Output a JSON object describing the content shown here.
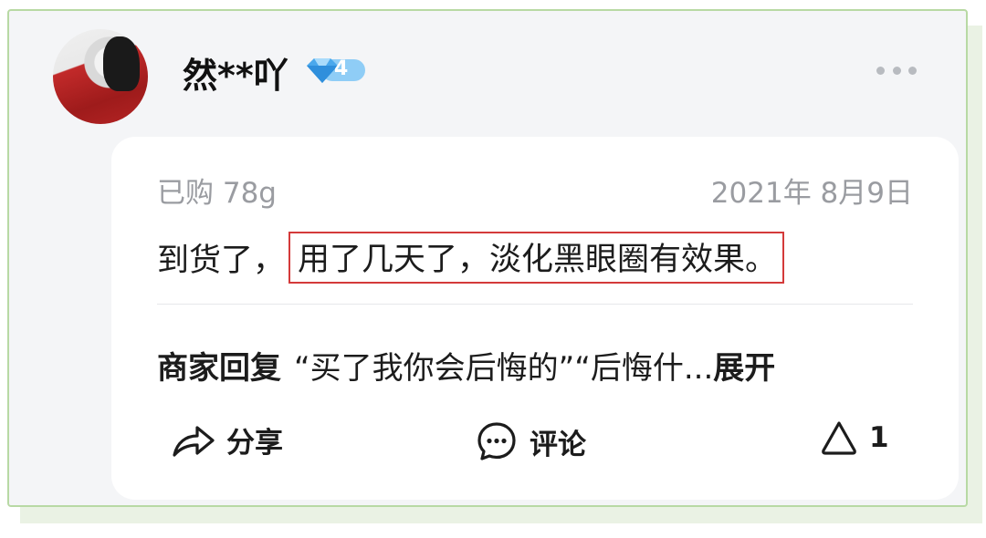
{
  "user": {
    "name": "然**吖",
    "level": "4"
  },
  "review": {
    "purchase": "已购 78g",
    "date": "2021年 8月9日",
    "text_prefix": "到货了，",
    "text_highlight": "用了几天了，淡化黑眼圈有效果。"
  },
  "merchant_reply": {
    "label": "商家回复",
    "text": "“买了我你会后悔的”“后悔什...",
    "expand": "展开"
  },
  "actions": {
    "share": "分享",
    "comment": "评论",
    "like_count": "1"
  },
  "colors": {
    "highlight_border": "#d43a3a",
    "badge_blue": "#4aa8ec",
    "frame_green": "#b8d9a4"
  }
}
